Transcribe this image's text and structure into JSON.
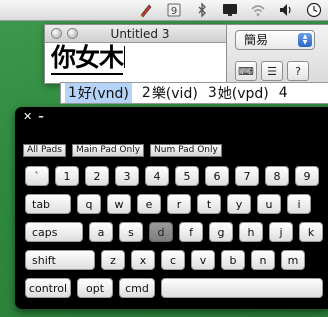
{
  "menubar": {
    "icons": [
      "pencil-icon",
      "input-menu-icon",
      "bluetooth-icon",
      "display-icon",
      "wifi-icon",
      "volume-icon",
      "clock-icon"
    ]
  },
  "document": {
    "title": "Untitled 3",
    "composing_text": "你女木"
  },
  "palette": {
    "input_mode": "簡易",
    "button_glyphs": [
      "⌨",
      "☰",
      "?"
    ]
  },
  "candidates": {
    "items": [
      {
        "num": "1",
        "text": "好(vnd)"
      },
      {
        "num": "2",
        "text": "樂(vid)"
      },
      {
        "num": "3",
        "text": "她(vpd)"
      }
    ],
    "extra": "4",
    "selected_index": 0
  },
  "keyboard": {
    "close_glyph": "✕",
    "minimize_glyph": "–",
    "modes": [
      "All Pads",
      "Main Pad Only",
      "Num Pad Only"
    ],
    "row1": [
      "`",
      "1",
      "2",
      "3",
      "4",
      "5",
      "6",
      "7",
      "8",
      "9"
    ],
    "row2": [
      "tab",
      "q",
      "w",
      "e",
      "r",
      "t",
      "y",
      "u",
      "i"
    ],
    "row3": [
      "caps",
      "a",
      "s",
      "d",
      "f",
      "g",
      "h",
      "j",
      "k"
    ],
    "row4": [
      "shift",
      "z",
      "x",
      "c",
      "v",
      "b",
      "n",
      "m"
    ],
    "row5": [
      "control",
      "opt",
      "cmd"
    ],
    "pressed_key": "d"
  },
  "colors": {
    "desktop": "#2f8a40",
    "selection": "#b5d3f7",
    "keyboard_bg": "#000000"
  }
}
